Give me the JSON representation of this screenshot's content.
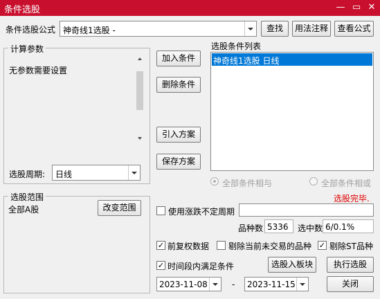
{
  "window": {
    "title": "条件选股"
  },
  "formula": {
    "label": "条件选股公式",
    "value": "神奇线1选股  -",
    "find_button": "查找",
    "usage_button": "用法注释",
    "view_button": "查看公式"
  },
  "params": {
    "group_label": "计算参数",
    "message": "无参数需要设置",
    "period_label": "选股周期:",
    "period_value": "日线"
  },
  "buttons": {
    "add": "加入条件",
    "remove": "删除条件",
    "import": "引入方案",
    "save": "保存方案"
  },
  "conditions": {
    "label": "选股条件列表",
    "items": [
      "神奇线1选股  日线"
    ],
    "selected_index": 0,
    "radio_and": "全部条件相与",
    "radio_or": "全部条件相或",
    "status": "选股完毕."
  },
  "scope": {
    "group_label": "选股范围",
    "value": "全部A股",
    "change_button": "改变范围"
  },
  "options": {
    "variable_period_label": "使用涨跌不定周期",
    "variable_period_checked": false,
    "count_label": "品种数",
    "count_value": "5336",
    "selected_label": "选中数",
    "selected_value": "6/0.1%",
    "forward_adjust_label": "前复权数据",
    "forward_adjust_checked": true,
    "exclude_untraded_label": "剔除当前未交易的品种",
    "exclude_untraded_checked": false,
    "exclude_st_label": "剔除ST品种",
    "exclude_st_checked": true,
    "time_range_label": "时间段内满足条件",
    "time_range_checked": true,
    "to_block_button": "选股入板块",
    "execute_button": "执行选股",
    "start_date": "2023-11-08",
    "date_separator": "-",
    "end_date": "2023-11-15",
    "close_button": "关闭"
  },
  "colors": {
    "titlebar": "#c8102e",
    "status": "#e00000",
    "list_selection": "#0078d7"
  }
}
